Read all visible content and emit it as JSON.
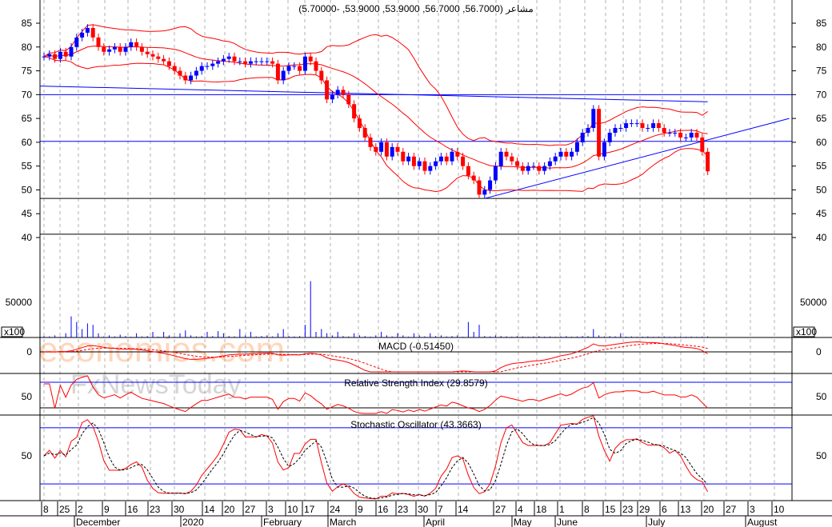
{
  "chart_data": {
    "type": "candlestick",
    "title": "مشاعر (56.7000, 56.7000, 53.9000, 53.9000, -5.70000)",
    "price_axis": {
      "ticks": [
        85,
        80,
        75,
        70,
        65,
        60,
        55,
        50,
        45,
        40
      ],
      "range": [
        40,
        85
      ]
    },
    "volume_axis": {
      "ticks": [
        50000
      ],
      "unit_label": "x100"
    },
    "closes": [
      78,
      78.5,
      77.5,
      79,
      78,
      80,
      82,
      83,
      84,
      82,
      80,
      79,
      79.5,
      80,
      79,
      80,
      81,
      80,
      79,
      78.5,
      78,
      77.5,
      77,
      76,
      75,
      74,
      73,
      74,
      75,
      76,
      76,
      76.5,
      77,
      77.5,
      78,
      77,
      77,
      76.5,
      77,
      77,
      77,
      77,
      76.5,
      73,
      75,
      76,
      76,
      75,
      78,
      77,
      75,
      73,
      69,
      70,
      71,
      70,
      68,
      65,
      63,
      61,
      59,
      58,
      60,
      57,
      59,
      58,
      56,
      57,
      55,
      56,
      54,
      55,
      56,
      57,
      56,
      58,
      57,
      55,
      53,
      52,
      49,
      50,
      52,
      55,
      58,
      57,
      56,
      55,
      54,
      55,
      55,
      54,
      55,
      56,
      57,
      58,
      57,
      58,
      60,
      62,
      63,
      67,
      57,
      60,
      62,
      63,
      63,
      64,
      64,
      64,
      63,
      63,
      64,
      63,
      62,
      62,
      62,
      61,
      61,
      62,
      61,
      58,
      53.9
    ],
    "volumes": [
      2000,
      1500,
      3000,
      1200,
      6000,
      30000,
      22000,
      12000,
      20000,
      18000,
      6000,
      1500,
      3000,
      1500,
      4000,
      2000,
      1000,
      6000,
      1500,
      2000,
      8000,
      1200,
      8000,
      3000,
      1500,
      6000,
      10000,
      3000,
      1500,
      2000,
      8000,
      2000,
      9000,
      6000,
      2000,
      1500,
      12000,
      3000,
      8000,
      1500,
      2000,
      3000,
      1500,
      6000,
      12000,
      2000,
      1500,
      2000,
      18000,
      80000,
      8000,
      12000,
      6000,
      3000,
      8000,
      2000,
      1500,
      6000,
      3000,
      2000,
      1200,
      3000,
      8000,
      3000,
      1500,
      6000,
      3000,
      1200,
      6000,
      3000,
      1500,
      6000,
      2000,
      3000,
      1500,
      2000,
      3000,
      1000,
      22000,
      8000,
      18000,
      2000,
      1500,
      3000,
      2000,
      1500,
      1200,
      2000,
      1500,
      1000,
      1500,
      2000,
      1200,
      1500,
      1000,
      1500,
      2000,
      1200,
      1500,
      2000,
      2000,
      12000,
      3000,
      1500,
      2000,
      1500,
      6000,
      1200,
      1500,
      1000,
      1200,
      1500,
      1000,
      1200,
      1500,
      1000,
      1200,
      1500,
      1000,
      1200,
      1000,
      1200,
      1500
    ],
    "horizontal_lines": [
      70,
      60.2,
      48.2,
      40.7
    ],
    "trendline": {
      "from": [
        81,
        48.2
      ],
      "to": [
        137,
        65
      ]
    },
    "long_ma_line": {
      "from": [
        0,
        71.8
      ],
      "to": [
        122,
        68.5
      ]
    },
    "indicators": {
      "macd": {
        "label": "MACD (-0.51450)",
        "zero_tick": "0"
      },
      "rsi": {
        "label": "Relative Strength Index (29.8579)",
        "tick": "50",
        "levels": [
          70,
          30
        ]
      },
      "stochastic": {
        "label": "Stochastic Oscillator (43.3663)",
        "tick": "50",
        "levels": [
          80,
          20
        ]
      }
    },
    "x_ticks": [
      "8",
      "25",
      "2",
      "9",
      "16",
      "23",
      "30",
      "14",
      "20",
      "27",
      "3",
      "10",
      "17",
      "24",
      "9",
      "16",
      "23",
      "30",
      "7",
      "14",
      "27",
      "4",
      "18",
      "1",
      "8",
      "15",
      "23",
      "29",
      "6",
      "13",
      "20",
      "27",
      "3",
      "10"
    ],
    "x_months": [
      "December",
      "2020",
      "February",
      "March",
      "April",
      "May",
      "June",
      "July",
      "August"
    ]
  },
  "watermark": {
    "line1": "economies.com",
    "line2": "FxNewsToday"
  },
  "colors": {
    "up": "#0000ff",
    "down": "#ff0000",
    "band": "#ff0000",
    "ma": "#0000ff",
    "grid": "#b0b0b0"
  }
}
